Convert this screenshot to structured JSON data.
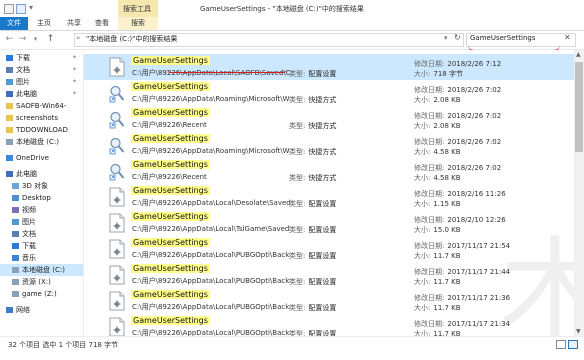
{
  "window": {
    "title": "GameUserSettings - \"本地磁盘 (C:)\"中的搜索结果",
    "contextual_tab": "搜索工具"
  },
  "ribbon": {
    "tabs": [
      "文件",
      "主页",
      "共享",
      "查看",
      "搜索"
    ]
  },
  "address": {
    "path": "\"本地磁盘 (C:)\"中的搜索结果"
  },
  "search": {
    "value": "GameUserSettings"
  },
  "sidebar": {
    "items": [
      {
        "label": "下载",
        "pinned": true
      },
      {
        "label": "文档",
        "pinned": true
      },
      {
        "label": "图片",
        "pinned": true
      },
      {
        "label": "此电脑",
        "pinned": true
      },
      {
        "label": "SAOFB-Win64-",
        "pinned": false
      },
      {
        "label": "screenshots",
        "pinned": false
      },
      {
        "label": "TDDOWNLOAD",
        "pinned": false
      },
      {
        "label": "本地磁盘 (C:)",
        "pinned": false
      },
      {
        "label": "OneDrive",
        "pinned": false
      },
      {
        "label": "此电脑",
        "pinned": false
      },
      {
        "label": "3D 对象",
        "pinned": false
      },
      {
        "label": "Desktop",
        "pinned": false
      },
      {
        "label": "视频",
        "pinned": false
      },
      {
        "label": "图片",
        "pinned": false
      },
      {
        "label": "文档",
        "pinned": false
      },
      {
        "label": "下载",
        "pinned": false
      },
      {
        "label": "音乐",
        "pinned": false
      },
      {
        "label": "本地磁盘 (C:)",
        "pinned": false
      },
      {
        "label": "资源 (X:)",
        "pinned": false
      },
      {
        "label": "game (Z:)",
        "pinned": false
      },
      {
        "label": "网络",
        "pinned": false
      }
    ]
  },
  "labels": {
    "type": "类型:",
    "modified": "修改日期:",
    "size": "大小:"
  },
  "files": [
    {
      "name": "GameUserSettings",
      "path": "C:\\用户\\89226\\AppData\\Local\\SAOFB\\Saved\\Co...",
      "type": "配置设置",
      "date": "2018/2/26 7:12",
      "size": "718 字节",
      "icon": "config"
    },
    {
      "name": "GameUserSettings",
      "path": "C:\\用户\\89226\\AppData\\Roaming\\Microsoft\\Wi...",
      "type": "快捷方式",
      "date": "2018/2/26 7:02",
      "size": "2.08 KB",
      "icon": "shortcut"
    },
    {
      "name": "GameUserSettings",
      "path": "C:\\用户\\89226\\Recent",
      "type": "快捷方式",
      "date": "2018/2/26 7:02",
      "size": "2.08 KB",
      "icon": "shortcut"
    },
    {
      "name": "GameUserSettings",
      "path": "C:\\用户\\89226\\AppData\\Roaming\\Microsoft\\Wi...",
      "type": "快捷方式",
      "date": "2018/2/26 7:02",
      "size": "4.58 KB",
      "icon": "shortcut"
    },
    {
      "name": "GameUserSettings",
      "path": "C:\\用户\\89226\\Recent",
      "type": "快捷方式",
      "date": "2018/2/26 7:02",
      "size": "4.58 KB",
      "icon": "shortcut"
    },
    {
      "name": "GameUserSettings",
      "path": "C:\\用户\\89226\\AppData\\Local\\Desolate\\Saved\\...",
      "type": "配置设置",
      "date": "2018/2/16 11:26",
      "size": "1.15 KB",
      "icon": "config"
    },
    {
      "name": "GameUserSettings",
      "path": "C:\\用户\\89226\\AppData\\Local\\TslGame\\Saved\\...",
      "type": "配置设置",
      "date": "2018/2/10 12:26",
      "size": "15.0 KB",
      "icon": "config"
    },
    {
      "name": "GameUserSettings",
      "path": "C:\\用户\\89226\\AppData\\Local\\PUBGOpti\\Backu...",
      "type": "配置设置",
      "date": "2017/11/17 21:54",
      "size": "11.7 KB",
      "icon": "config"
    },
    {
      "name": "GameUserSettings",
      "path": "C:\\用户\\89226\\AppData\\Local\\PUBGOpti\\Backu...",
      "type": "配置设置",
      "date": "2017/11/17 21:44",
      "size": "11.7 KB",
      "icon": "config"
    },
    {
      "name": "GameUserSettings",
      "path": "C:\\用户\\89226\\AppData\\Local\\PUBGOpti\\Backu...",
      "type": "配置设置",
      "date": "2017/11/17 21:36",
      "size": "11.7 KB",
      "icon": "config"
    },
    {
      "name": "GameUserSettings",
      "path": "C:\\用户\\89226\\AppData\\Local\\PUBGOpti\\Backu...",
      "type": "配置设置",
      "date": "2017/11/17 21:34",
      "size": "11.7 KB",
      "icon": "config"
    }
  ],
  "status": {
    "text": "32 个项目    选中 1 个项目  718 字节"
  },
  "colors": {
    "accent": "#1979ca",
    "selection": "#cce8ff",
    "highlight": "#ffff8a",
    "annotation": "#d41d1d"
  }
}
